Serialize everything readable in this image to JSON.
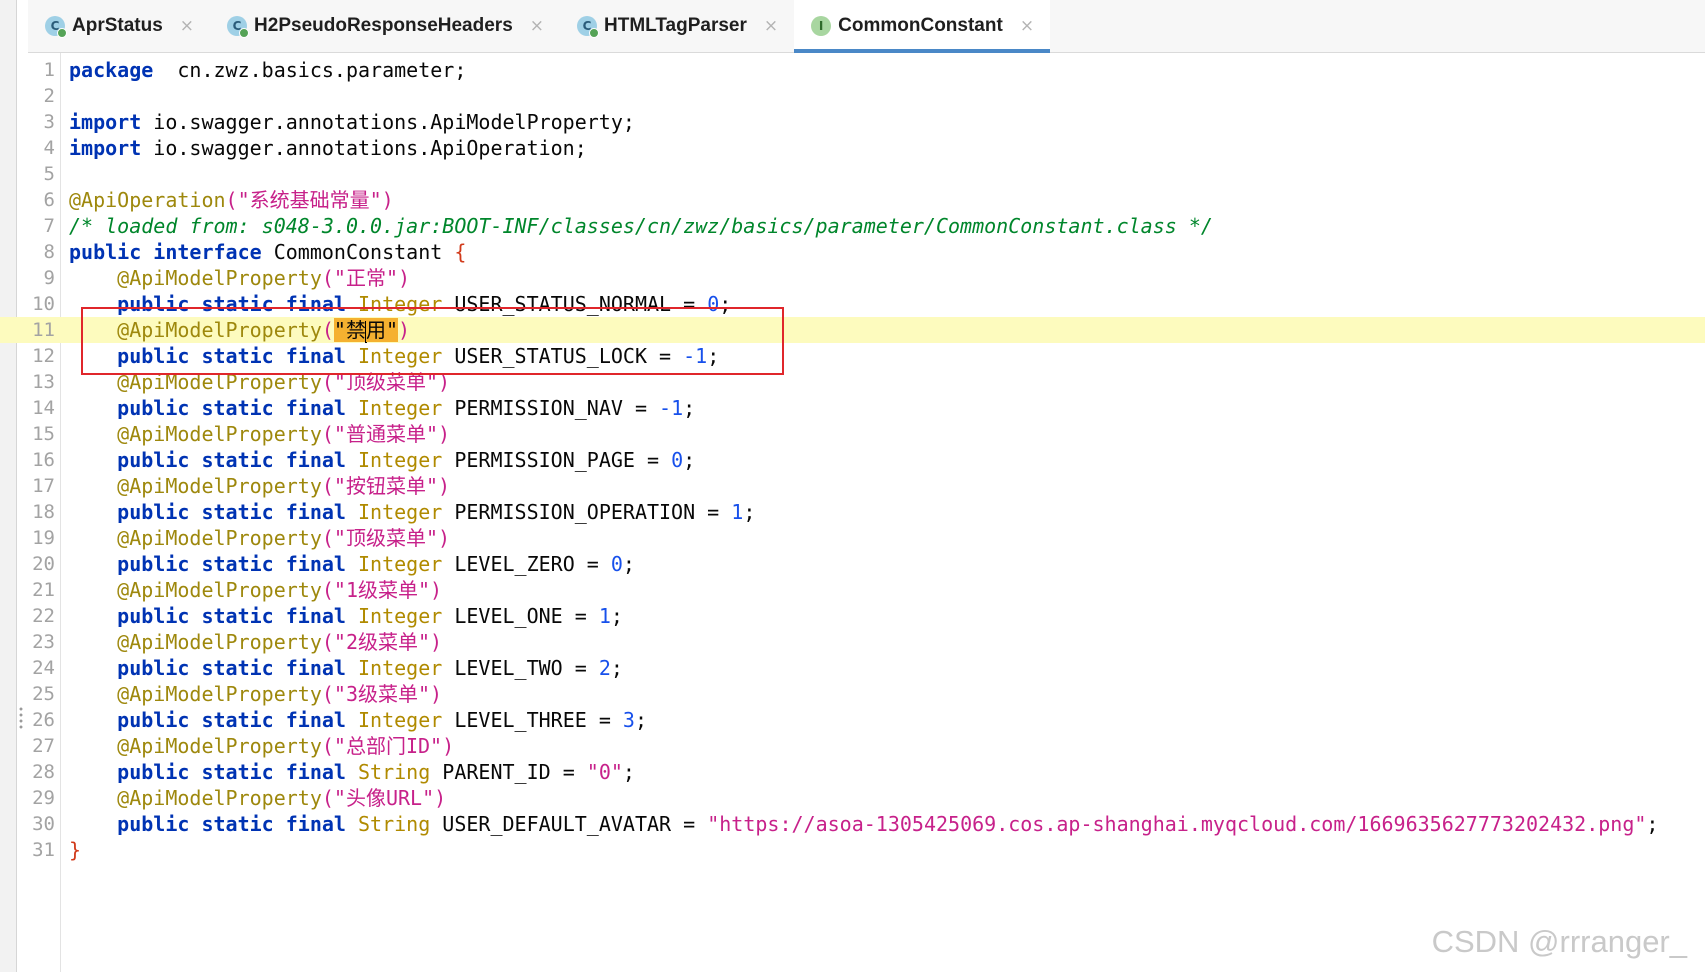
{
  "tabs": [
    {
      "icon_name": "class-icon",
      "icon_letter": "C",
      "label": "AprStatus",
      "active": false
    },
    {
      "icon_name": "class-icon",
      "icon_letter": "C",
      "label": "H2PseudoResponseHeaders",
      "active": false
    },
    {
      "icon_name": "class-icon",
      "icon_letter": "C",
      "label": "HTMLTagParser",
      "active": false
    },
    {
      "icon_name": "interface-icon",
      "icon_letter": "I",
      "label": "CommonConstant",
      "active": true
    }
  ],
  "tab_close_glyph": "×",
  "editor": {
    "current_line": 11,
    "lines": [
      {
        "n": "1",
        "t": [
          [
            "kw",
            "package"
          ],
          [
            "",
            "  cn.zwz.basics.parameter;"
          ]
        ]
      },
      {
        "n": "2",
        "t": []
      },
      {
        "n": "3",
        "t": [
          [
            "kw",
            "import"
          ],
          [
            "",
            " io.swagger.annotations.ApiModelProperty;"
          ]
        ]
      },
      {
        "n": "4",
        "t": [
          [
            "kw",
            "import"
          ],
          [
            "",
            " io.swagger.annotations.ApiOperation;"
          ]
        ]
      },
      {
        "n": "5",
        "t": []
      },
      {
        "n": "6",
        "t": [
          [
            "ann",
            "@ApiOperation"
          ],
          [
            "str",
            "(\"系统基础常量\")"
          ]
        ]
      },
      {
        "n": "7",
        "t": [
          [
            "cm",
            "/* loaded from: s048-3.0.0.jar:BOOT-INF/classes/cn/zwz/basics/parameter/CommonConstant.class */"
          ]
        ]
      },
      {
        "n": "8",
        "t": [
          [
            "kw",
            "public interface"
          ],
          [
            "",
            " CommonConstant "
          ],
          [
            "brace",
            "{"
          ]
        ]
      },
      {
        "n": "9",
        "t": [
          [
            "",
            "    "
          ],
          [
            "ann",
            "@ApiModelProperty"
          ],
          [
            "str",
            "(\"正常\")"
          ]
        ]
      },
      {
        "n": "10",
        "t": [
          [
            "",
            "    "
          ],
          [
            "kw",
            "public static final"
          ],
          [
            "type",
            " Integer"
          ],
          [
            "",
            " USER_STATUS_NORMAL = "
          ],
          [
            "num",
            "0"
          ],
          [
            "",
            ";"
          ]
        ]
      },
      {
        "n": "11",
        "t": [
          [
            "",
            "    "
          ],
          [
            "ann",
            "@ApiModelProperty"
          ],
          [
            "str",
            "("
          ],
          [
            "hl",
            "\"禁"
          ],
          [
            "caret",
            ""
          ],
          [
            "hl",
            "用\""
          ],
          [
            "str",
            ")"
          ]
        ]
      },
      {
        "n": "12",
        "t": [
          [
            "",
            "    "
          ],
          [
            "kw",
            "public static final"
          ],
          [
            "type",
            " Integer"
          ],
          [
            "",
            " USER_STATUS_LOCK = "
          ],
          [
            "num",
            "-1"
          ],
          [
            "",
            ";"
          ]
        ]
      },
      {
        "n": "13",
        "t": [
          [
            "",
            "    "
          ],
          [
            "ann",
            "@ApiModelProperty"
          ],
          [
            "str",
            "(\"顶级菜单\")"
          ]
        ]
      },
      {
        "n": "14",
        "t": [
          [
            "",
            "    "
          ],
          [
            "kw",
            "public static final"
          ],
          [
            "type",
            " Integer"
          ],
          [
            "",
            " PERMISSION_NAV = "
          ],
          [
            "num",
            "-1"
          ],
          [
            "",
            ";"
          ]
        ]
      },
      {
        "n": "15",
        "t": [
          [
            "",
            "    "
          ],
          [
            "ann",
            "@ApiModelProperty"
          ],
          [
            "str",
            "(\"普通菜单\")"
          ]
        ]
      },
      {
        "n": "16",
        "t": [
          [
            "",
            "    "
          ],
          [
            "kw",
            "public static final"
          ],
          [
            "type",
            " Integer"
          ],
          [
            "",
            " PERMISSION_PAGE = "
          ],
          [
            "num",
            "0"
          ],
          [
            "",
            ";"
          ]
        ]
      },
      {
        "n": "17",
        "t": [
          [
            "",
            "    "
          ],
          [
            "ann",
            "@ApiModelProperty"
          ],
          [
            "str",
            "(\"按钮菜单\")"
          ]
        ]
      },
      {
        "n": "18",
        "t": [
          [
            "",
            "    "
          ],
          [
            "kw",
            "public static final"
          ],
          [
            "type",
            " Integer"
          ],
          [
            "",
            " PERMISSION_OPERATION = "
          ],
          [
            "num",
            "1"
          ],
          [
            "",
            ";"
          ]
        ]
      },
      {
        "n": "19",
        "t": [
          [
            "",
            "    "
          ],
          [
            "ann",
            "@ApiModelProperty"
          ],
          [
            "str",
            "(\"顶级菜单\")"
          ]
        ]
      },
      {
        "n": "20",
        "t": [
          [
            "",
            "    "
          ],
          [
            "kw",
            "public static final"
          ],
          [
            "type",
            " Integer"
          ],
          [
            "",
            " LEVEL_ZERO = "
          ],
          [
            "num",
            "0"
          ],
          [
            "",
            ";"
          ]
        ]
      },
      {
        "n": "21",
        "t": [
          [
            "",
            "    "
          ],
          [
            "ann",
            "@ApiModelProperty"
          ],
          [
            "str",
            "(\"1级菜单\")"
          ]
        ]
      },
      {
        "n": "22",
        "t": [
          [
            "",
            "    "
          ],
          [
            "kw",
            "public static final"
          ],
          [
            "type",
            " Integer"
          ],
          [
            "",
            " LEVEL_ONE = "
          ],
          [
            "num",
            "1"
          ],
          [
            "",
            ";"
          ]
        ]
      },
      {
        "n": "23",
        "t": [
          [
            "",
            "    "
          ],
          [
            "ann",
            "@ApiModelProperty"
          ],
          [
            "str",
            "(\"2级菜单\")"
          ]
        ]
      },
      {
        "n": "24",
        "t": [
          [
            "",
            "    "
          ],
          [
            "kw",
            "public static final"
          ],
          [
            "type",
            " Integer"
          ],
          [
            "",
            " LEVEL_TWO = "
          ],
          [
            "num",
            "2"
          ],
          [
            "",
            ";"
          ]
        ]
      },
      {
        "n": "25",
        "t": [
          [
            "",
            "    "
          ],
          [
            "ann",
            "@ApiModelProperty"
          ],
          [
            "str",
            "(\"3级菜单\")"
          ]
        ]
      },
      {
        "n": "26",
        "t": [
          [
            "",
            "    "
          ],
          [
            "kw",
            "public static final"
          ],
          [
            "type",
            " Integer"
          ],
          [
            "",
            " LEVEL_THREE = "
          ],
          [
            "num",
            "3"
          ],
          [
            "",
            ";"
          ]
        ]
      },
      {
        "n": "27",
        "t": [
          [
            "",
            "    "
          ],
          [
            "ann",
            "@ApiModelProperty"
          ],
          [
            "str",
            "(\"总部门ID\")"
          ]
        ]
      },
      {
        "n": "28",
        "t": [
          [
            "",
            "    "
          ],
          [
            "kw",
            "public static final"
          ],
          [
            "type",
            " String"
          ],
          [
            "",
            " PARENT_ID = "
          ],
          [
            "str",
            "\"0\""
          ],
          [
            "",
            ";"
          ]
        ]
      },
      {
        "n": "29",
        "t": [
          [
            "",
            "    "
          ],
          [
            "ann",
            "@ApiModelProperty"
          ],
          [
            "str",
            "(\"头像URL\")"
          ]
        ]
      },
      {
        "n": "30",
        "t": [
          [
            "",
            "    "
          ],
          [
            "kw",
            "public static final"
          ],
          [
            "type",
            " String"
          ],
          [
            "",
            " USER_DEFAULT_AVATAR = "
          ],
          [
            "str",
            "\"https://asoa-1305425069.cos.ap-shanghai.myqcloud.com/1669635627773202432.png\""
          ],
          [
            "",
            ";"
          ]
        ]
      },
      {
        "n": "31",
        "t": [
          [
            "brace",
            "}"
          ]
        ]
      }
    ]
  },
  "watermark": "CSDN @rrranger_",
  "colors": {
    "keyword": "#0033b3",
    "annotation": "#9e880d",
    "string": "#c7218a",
    "number": "#1750eb",
    "type": "#b08a00",
    "comment": "#00862b",
    "current_line_bg": "#fdfbbe",
    "highlight_box": "#e0262b",
    "active_tab_underline": "#4a88c7"
  }
}
